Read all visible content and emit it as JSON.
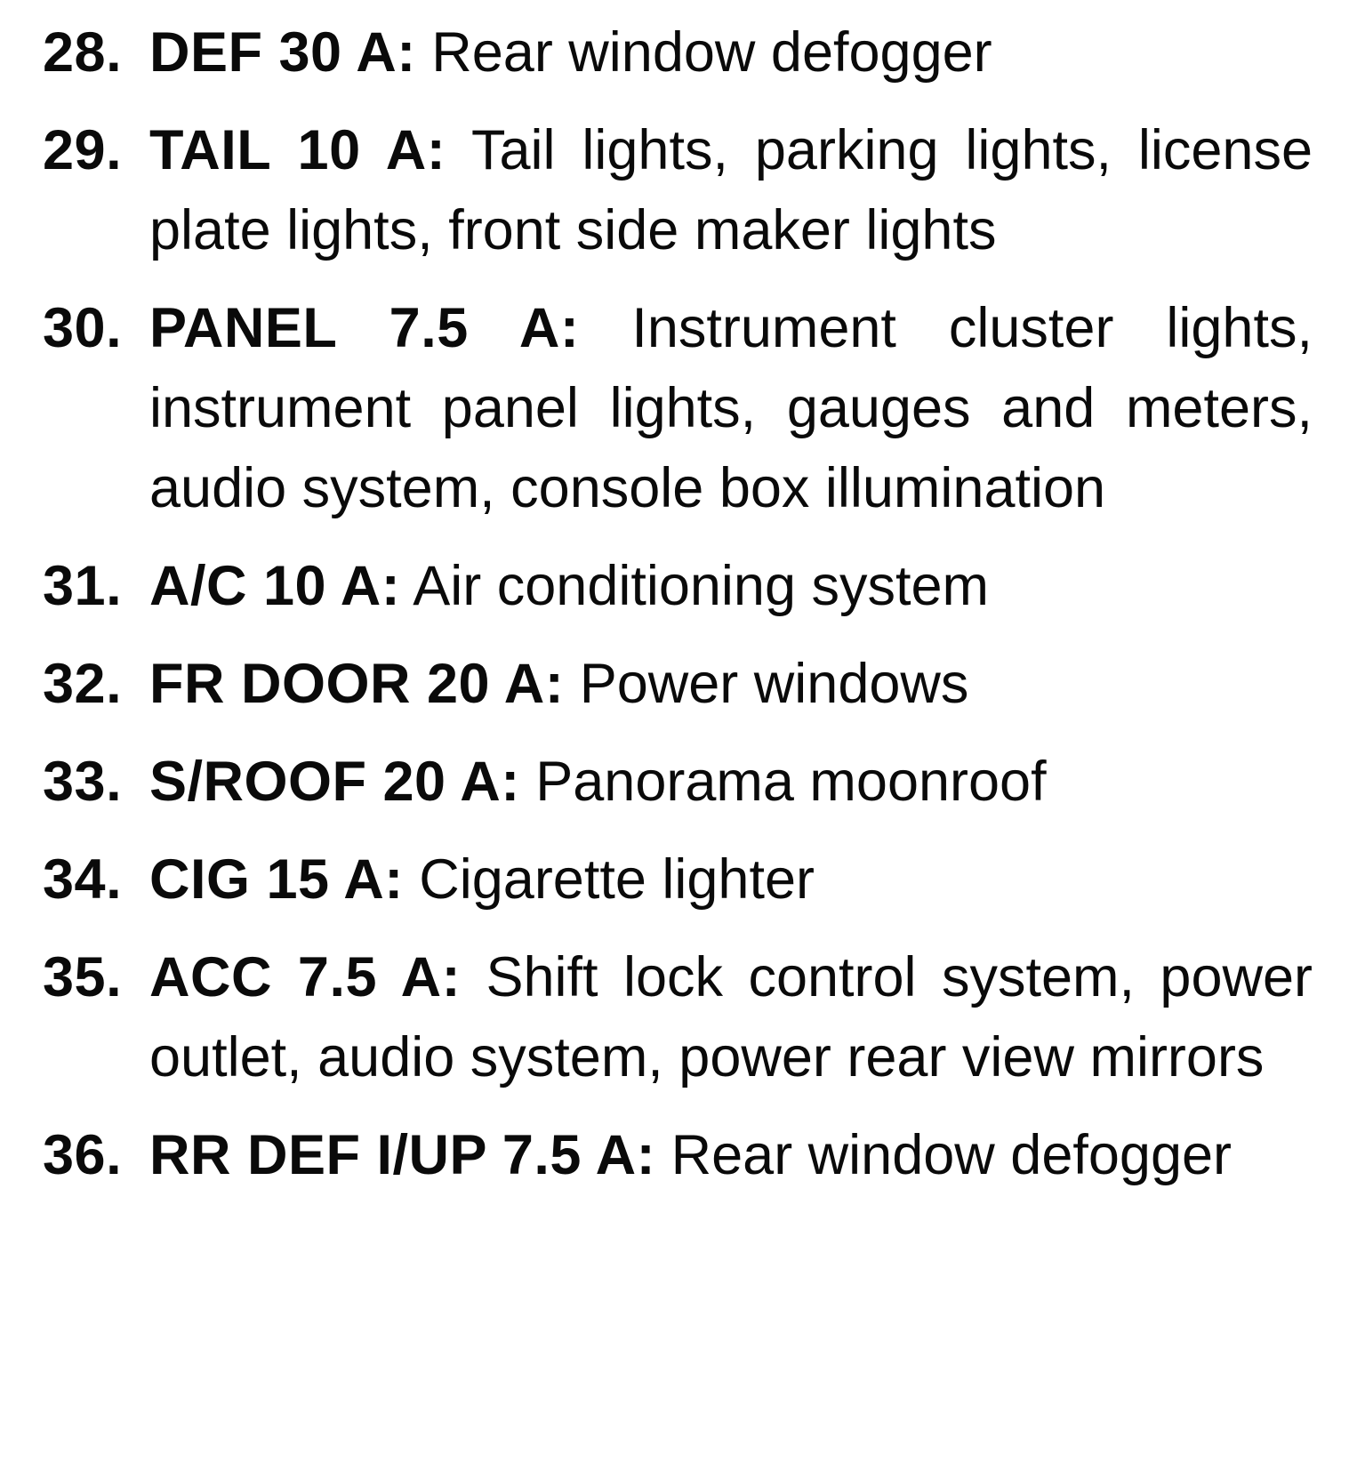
{
  "document": {
    "kind": "fuse-box-legend",
    "text_color": "#0a0a0a",
    "background_color": "#ffffff"
  },
  "fuses": [
    {
      "number": "28.",
      "label": "DEF 30 A:",
      "name": "DEF",
      "rating": "30 A",
      "description": "Rear window defogger"
    },
    {
      "number": "29.",
      "label": "TAIL 10 A:",
      "name": "TAIL",
      "rating": "10 A",
      "description": "Tail lights, parking lights, license plate lights, front side maker lights"
    },
    {
      "number": "30.",
      "label": "PANEL 7.5 A:",
      "name": "PANEL",
      "rating": "7.5 A",
      "description": "Instrument cluster lights, instrument panel lights, gauges and meters, audio system, console box illumination"
    },
    {
      "number": "31.",
      "label": "A/C 10 A:",
      "name": "A/C",
      "rating": "10 A",
      "description": "Air conditioning system"
    },
    {
      "number": "32.",
      "label": "FR DOOR 20 A:",
      "name": "FR DOOR",
      "rating": "20 A",
      "description": "Power windows"
    },
    {
      "number": "33.",
      "label": "S/ROOF 20 A:",
      "name": "S/ROOF",
      "rating": "20 A",
      "description": "Panorama moonroof"
    },
    {
      "number": "34.",
      "label": "CIG 15 A:",
      "name": "CIG",
      "rating": "15 A",
      "description": "Cigarette lighter"
    },
    {
      "number": "35.",
      "label": "ACC 7.5 A:",
      "name": "ACC",
      "rating": "7.5 A",
      "description": "Shift lock control system, power outlet, audio system, power rear view mirrors"
    },
    {
      "number": "36.",
      "label": "RR DEF I/UP 7.5 A:",
      "name": "RR DEF I/UP",
      "rating": "7.5 A",
      "description": "Rear window defogger"
    }
  ]
}
